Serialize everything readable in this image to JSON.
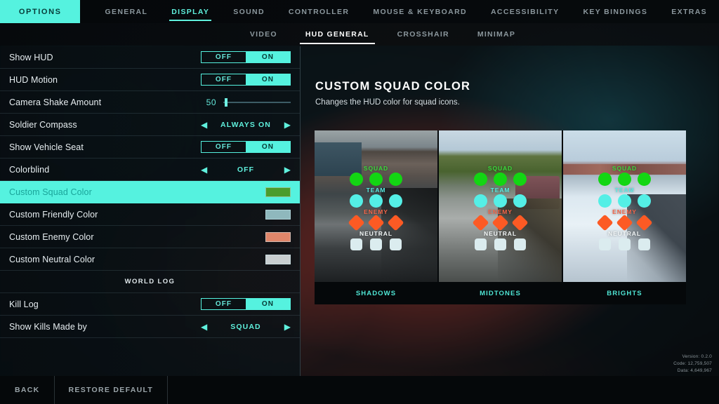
{
  "topnav": {
    "options_label": "OPTIONS",
    "items": [
      {
        "label": "GENERAL",
        "active": false
      },
      {
        "label": "DISPLAY",
        "active": true
      },
      {
        "label": "SOUND",
        "active": false
      },
      {
        "label": "CONTROLLER",
        "active": false
      },
      {
        "label": "MOUSE & KEYBOARD",
        "active": false
      },
      {
        "label": "ACCESSIBILITY",
        "active": false
      },
      {
        "label": "KEY BINDINGS",
        "active": false
      },
      {
        "label": "EXTRAS",
        "active": false
      }
    ]
  },
  "subnav": {
    "items": [
      {
        "label": "VIDEO",
        "active": false
      },
      {
        "label": "HUD GENERAL",
        "active": true
      },
      {
        "label": "CROSSHAIR",
        "active": false
      },
      {
        "label": "MINIMAP",
        "active": false
      }
    ]
  },
  "settings": {
    "rows": [
      {
        "type": "toggle",
        "label": "Show HUD",
        "off_label": "OFF",
        "on_label": "ON",
        "value": "ON"
      },
      {
        "type": "toggle",
        "label": "HUD Motion",
        "off_label": "OFF",
        "on_label": "ON",
        "value": "ON"
      },
      {
        "type": "slider",
        "label": "Camera Shake Amount",
        "value": "50",
        "min": 0,
        "max": 100,
        "percent": 50
      },
      {
        "type": "arrows",
        "label": "Soldier Compass",
        "value": "ALWAYS ON",
        "left_arrow": "◀",
        "right_arrow": "▶"
      },
      {
        "type": "toggle",
        "label": "Show Vehicle Seat",
        "off_label": "OFF",
        "on_label": "ON",
        "value": "ON"
      },
      {
        "type": "arrows",
        "label": "Colorblind",
        "value": "OFF",
        "left_arrow": "◀",
        "right_arrow": "▶"
      },
      {
        "type": "swatch",
        "label": "Custom Squad Color",
        "color": "#4a9c2c",
        "selected": true
      },
      {
        "type": "swatch",
        "label": "Custom Friendly Color",
        "color": "#8fb8bd",
        "selected": false
      },
      {
        "type": "swatch",
        "label": "Custom Enemy Color",
        "color": "#e0866a",
        "selected": false
      },
      {
        "type": "swatch",
        "label": "Custom Neutral Color",
        "color": "#c9ced0",
        "selected": false
      },
      {
        "type": "header",
        "label": "WORLD LOG"
      },
      {
        "type": "toggle",
        "label": "Kill Log",
        "off_label": "OFF",
        "on_label": "ON",
        "value": "ON"
      },
      {
        "type": "arrows",
        "label": "Show Kills Made by",
        "value": "SQUAD",
        "left_arrow": "◀",
        "right_arrow": "▶"
      }
    ]
  },
  "detail": {
    "title": "CUSTOM SQUAD COLOR",
    "description": "Changes the HUD color for squad icons.",
    "icon_groups": [
      {
        "label": "SQUAD",
        "shape": "circle",
        "color": "#13d613",
        "label_color": "#39d93b",
        "count": 3
      },
      {
        "label": "TEAM",
        "shape": "circle",
        "color": "#54efe6",
        "label_color": "#59ece3",
        "count": 3
      },
      {
        "label": "ENEMY",
        "shape": "diamond",
        "color": "#fc5a24",
        "label_color": "#f4664a",
        "count": 3
      },
      {
        "label": "NEUTRAL",
        "shape": "square",
        "color": "#dbecef",
        "label_color": "#f2f6f7",
        "count": 3
      }
    ],
    "previews": [
      {
        "label": "SHADOWS",
        "scene": "scene-shadows"
      },
      {
        "label": "MIDTONES",
        "scene": "scene-midtones"
      },
      {
        "label": "BRIGHTS",
        "scene": "scene-brights"
      }
    ]
  },
  "version": {
    "version_line": "Version: 0.2.0",
    "code_line": "Code: 12,759,507",
    "data_line": "Data: 4,649,967"
  },
  "bottombar": {
    "buttons": [
      {
        "label": "BACK"
      },
      {
        "label": "RESTORE DEFAULT"
      }
    ]
  },
  "colors": {
    "accent_cyan": "#55f2df",
    "panel_bg": "#0a1114",
    "text_primary": "#e7eef1",
    "text_muted": "#8b979d"
  }
}
